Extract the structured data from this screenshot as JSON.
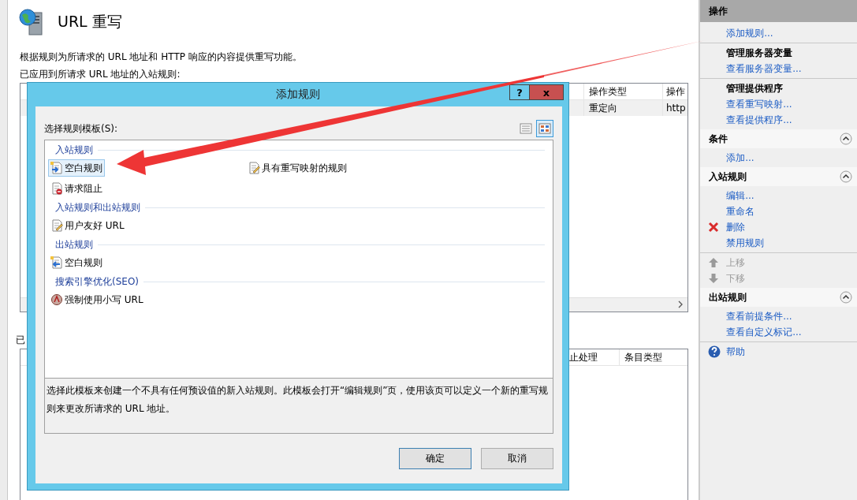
{
  "page": {
    "title": "URL 重写",
    "description": "根据规则为所请求的 URL 地址和 HTTP 响应的内容提供重写功能。",
    "inbound_label": "已应用到所请求 URL 地址的入站规则:",
    "outbound_label": "已"
  },
  "inbound_table": {
    "columns": [
      "操作类型",
      "操作"
    ],
    "rows": [
      [
        "重定向",
        "http"
      ]
    ]
  },
  "outbound_table": {
    "columns": [
      "止处理",
      "条目类型"
    ]
  },
  "dialog": {
    "title": "添加规则",
    "help_button": "?",
    "close_button": "x",
    "template_label": "选择规则模板(S):",
    "view_buttons": [
      {
        "kind": "details",
        "selected": false
      },
      {
        "kind": "tiles",
        "selected": true
      }
    ],
    "groups": [
      {
        "title": "入站规则",
        "items": [
          {
            "label": "空白规则",
            "kind": "blank-in",
            "selected": true
          },
          {
            "label": "具有重写映射的规则",
            "kind": "edit",
            "selected": false
          },
          {
            "label": "请求阻止",
            "kind": "block",
            "selected": false
          }
        ]
      },
      {
        "title": "入站规则和出站规则",
        "items": [
          {
            "label": "用户友好 URL",
            "kind": "edit",
            "selected": false
          }
        ]
      },
      {
        "title": "出站规则",
        "items": [
          {
            "label": "空白规则",
            "kind": "blank-out",
            "selected": false
          }
        ]
      },
      {
        "title": "搜索引擎优化(SEO)",
        "items": [
          {
            "label": "强制使用小写 URL",
            "kind": "lowercase",
            "selected": false
          }
        ]
      }
    ],
    "description": "选择此模板来创建一个不具有任何预设值的新入站规则。此模板会打开“编辑规则”页，使用该页可以定义一个新的重写规则来更改所请求的 URL 地址。",
    "buttons": [
      {
        "label": "确定",
        "default": true
      },
      {
        "label": "取消",
        "default": false
      }
    ]
  },
  "actions": [
    {
      "title": "操作",
      "kind": "primary",
      "groups": [
        {
          "links": [
            {
              "label": "添加规则...",
              "kind": "link",
              "disabled": false
            }
          ]
        },
        {
          "heading": "管理服务器变量",
          "links": [
            {
              "label": "查看服务器变量...",
              "kind": "link",
              "disabled": false
            }
          ]
        },
        {
          "heading": "管理提供程序",
          "links": [
            {
              "label": "查看重写映射...",
              "kind": "link",
              "disabled": false
            },
            {
              "label": "查看提供程序...",
              "kind": "link",
              "disabled": false
            }
          ]
        }
      ]
    },
    {
      "title": "条件",
      "kind": "collapsible",
      "expanded": true,
      "groups": [
        {
          "links": [
            {
              "label": "添加...",
              "kind": "link",
              "disabled": false
            }
          ]
        }
      ]
    },
    {
      "title": "入站规则",
      "kind": "collapsible",
      "expanded": true,
      "groups": [
        {
          "links": [
            {
              "label": "编辑...",
              "kind": "link",
              "disabled": false
            },
            {
              "label": "重命名",
              "kind": "link",
              "disabled": false
            },
            {
              "label": "删除",
              "kind": "delete",
              "disabled": false
            },
            {
              "label": "禁用规则",
              "kind": "link",
              "disabled": false
            }
          ]
        },
        {
          "links": [
            {
              "label": "上移",
              "kind": "up",
              "disabled": true
            },
            {
              "label": "下移",
              "kind": "down",
              "disabled": true
            }
          ]
        }
      ]
    },
    {
      "title": "出站规则",
      "kind": "collapsible",
      "expanded": true,
      "groups": [
        {
          "links": [
            {
              "label": "查看前提条件...",
              "kind": "link",
              "disabled": false
            },
            {
              "label": "查看自定义标记...",
              "kind": "link",
              "disabled": false
            }
          ]
        },
        {
          "links": [
            {
              "label": "帮助",
              "kind": "help",
              "disabled": false
            }
          ]
        }
      ]
    }
  ]
}
